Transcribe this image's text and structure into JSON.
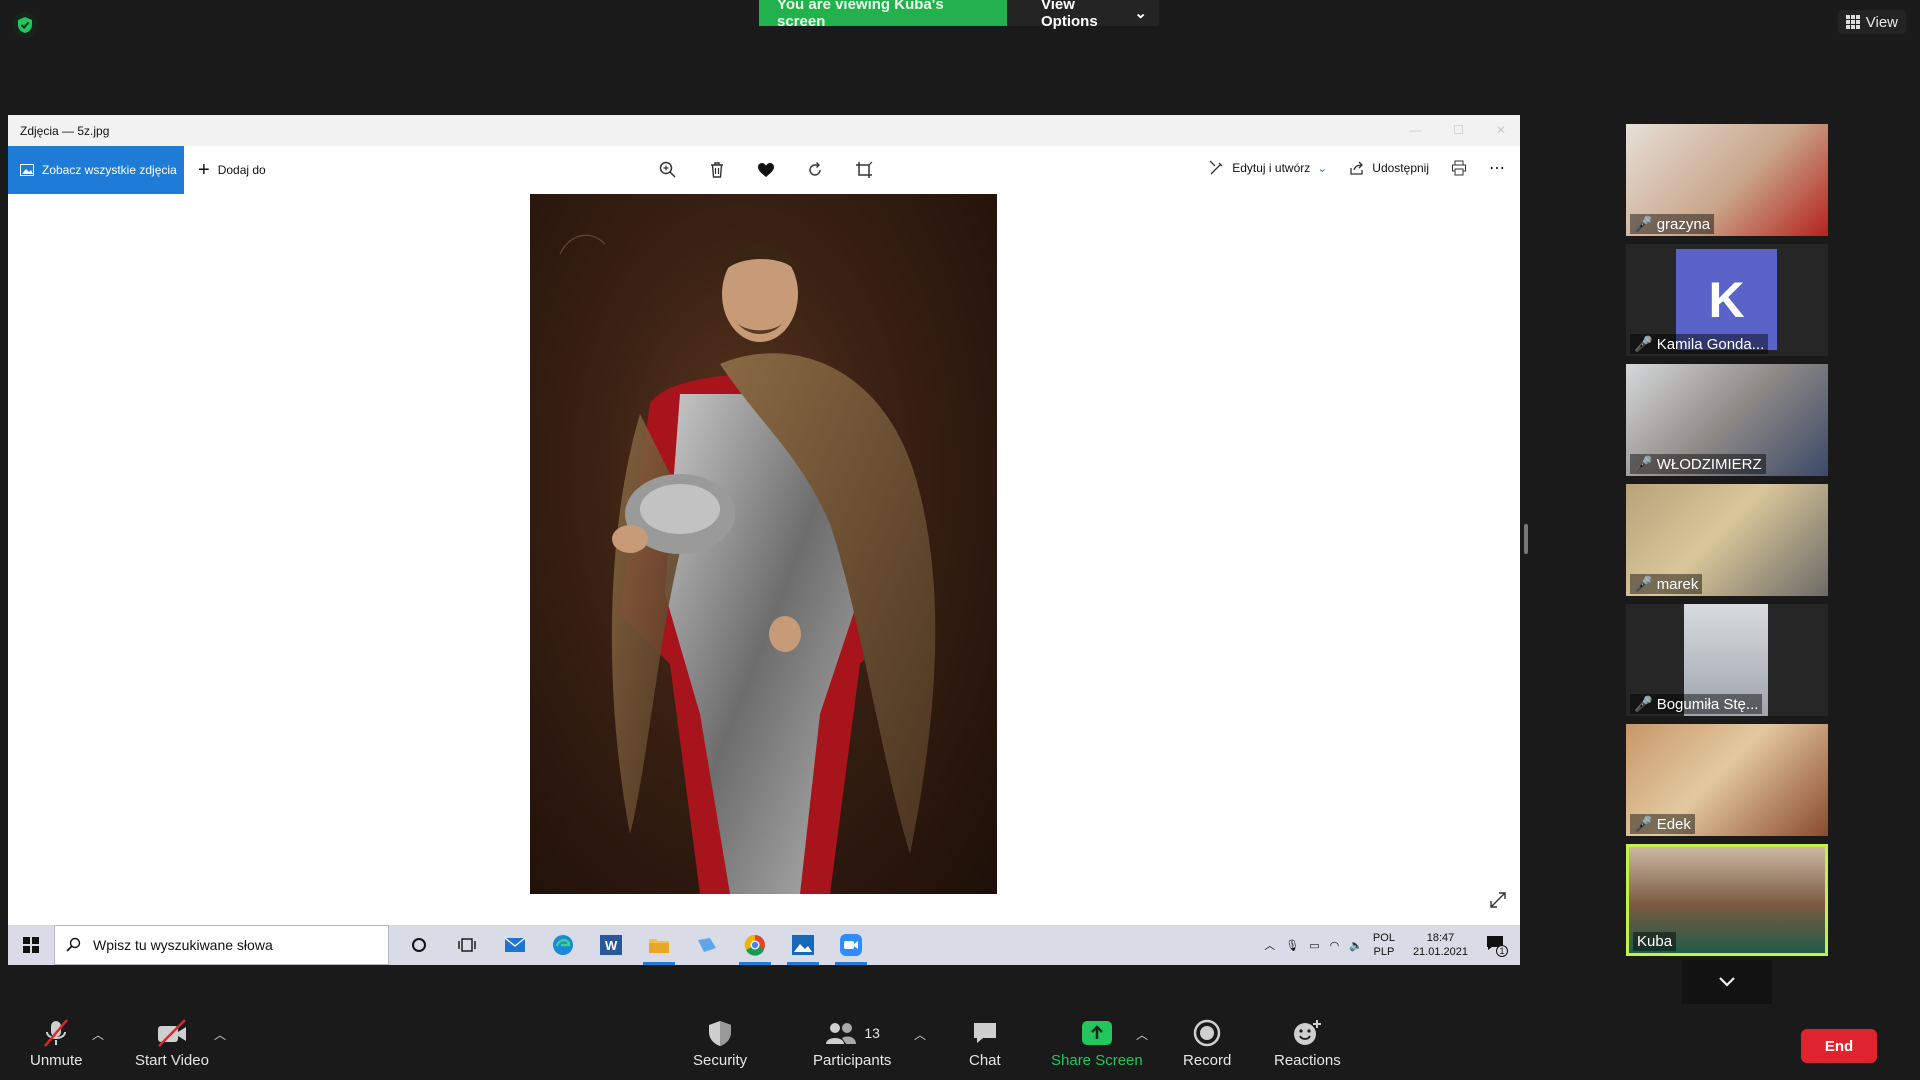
{
  "meeting": {
    "viewing_banner": "You are viewing Kuba's screen",
    "view_options_label": "View Options",
    "view_label": "View"
  },
  "photos_app": {
    "window_title": "Zdjęcia — 5z.jpg",
    "see_all_label": "Zobacz wszystkie zdjęcia",
    "add_to_label": "Dodaj do",
    "edit_create_label": "Edytuj i utwórz",
    "share_label": "Udostępnij",
    "tools": [
      "zoom-icon",
      "delete-icon",
      "favorite-icon",
      "rotate-icon",
      "crop-icon"
    ]
  },
  "taskbar": {
    "search_placeholder": "Wpisz tu wyszukiwane słowa",
    "lang_top": "POL",
    "lang_bottom": "PLP",
    "time": "18:47",
    "date": "21.01.2021",
    "notification_count": "1",
    "apps": [
      "cortana-icon",
      "task-view-icon",
      "mail-icon",
      "edge-icon",
      "word-icon",
      "file-explorer-icon",
      "app-icon",
      "chrome-icon",
      "photos-icon",
      "zoom-icon"
    ]
  },
  "participants": [
    {
      "name": "grazyna",
      "muted": true
    },
    {
      "name": "Kamila Gonda...",
      "muted": true,
      "avatar_letter": "K"
    },
    {
      "name": "WŁODZIMIERZ",
      "muted": true
    },
    {
      "name": "marek",
      "muted": true
    },
    {
      "name": "Bogumiła Stę...",
      "muted": true
    },
    {
      "name": "Edek",
      "muted": true
    },
    {
      "name": "Kuba",
      "muted": false,
      "active_speaker": true
    }
  ],
  "controls": {
    "unmute": "Unmute",
    "start_video": "Start Video",
    "security": "Security",
    "participants": "Participants",
    "participants_count": "13",
    "chat": "Chat",
    "share_screen": "Share Screen",
    "record": "Record",
    "reactions": "Reactions",
    "end": "End"
  },
  "colors": {
    "banner_green": "#22b14c",
    "photos_accent": "#1e7bd6",
    "share_green": "#22c55e",
    "end_red": "#e0242f",
    "active_border": "#c4f04a"
  }
}
